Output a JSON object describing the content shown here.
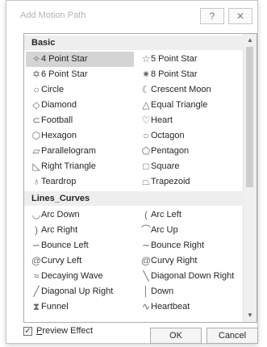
{
  "dialog": {
    "title": "Add Motion Path",
    "help_icon": "question-mark-icon",
    "close_icon": "close-icon"
  },
  "sections": [
    {
      "header": "Basic",
      "items": [
        {
          "label": "4 Point Star",
          "icon": "four-point-star-icon",
          "glyph": "✧",
          "selected": true
        },
        {
          "label": "5 Point Star",
          "icon": "five-point-star-icon",
          "glyph": "☆"
        },
        {
          "label": "6 Point Star",
          "icon": "six-point-star-icon",
          "glyph": "✡"
        },
        {
          "label": "8 Point Star",
          "icon": "eight-point-star-icon",
          "glyph": "✷"
        },
        {
          "label": "Circle",
          "icon": "circle-icon",
          "glyph": "○"
        },
        {
          "label": "Crescent Moon",
          "icon": "crescent-moon-icon",
          "glyph": "☾"
        },
        {
          "label": "Diamond",
          "icon": "diamond-icon",
          "glyph": "◇"
        },
        {
          "label": "Equal Triangle",
          "icon": "equal-triangle-icon",
          "glyph": "△"
        },
        {
          "label": "Football",
          "icon": "football-icon",
          "glyph": "⊂"
        },
        {
          "label": "Heart",
          "icon": "heart-icon",
          "glyph": "♡"
        },
        {
          "label": "Hexagon",
          "icon": "hexagon-icon",
          "glyph": "⬡"
        },
        {
          "label": "Octagon",
          "icon": "octagon-icon",
          "glyph": "○"
        },
        {
          "label": "Parallelogram",
          "icon": "parallelogram-icon",
          "glyph": "▱"
        },
        {
          "label": "Pentagon",
          "icon": "pentagon-icon",
          "glyph": "⬠"
        },
        {
          "label": "Right Triangle",
          "icon": "right-triangle-icon",
          "glyph": "◺"
        },
        {
          "label": "Square",
          "icon": "square-icon",
          "glyph": "□"
        },
        {
          "label": "Teardrop",
          "icon": "teardrop-icon",
          "glyph": "♁"
        },
        {
          "label": "Trapezoid",
          "icon": "trapezoid-icon",
          "glyph": "⏢"
        }
      ]
    },
    {
      "header": "Lines_Curves",
      "items": [
        {
          "label": "Arc Down",
          "icon": "arc-down-icon",
          "glyph": "◡"
        },
        {
          "label": "Arc Left",
          "icon": "arc-left-icon",
          "glyph": "("
        },
        {
          "label": "Arc Right",
          "icon": "arc-right-icon",
          "glyph": ")"
        },
        {
          "label": "Arc Up",
          "icon": "arc-up-icon",
          "glyph": "⌒"
        },
        {
          "label": "Bounce Left",
          "icon": "bounce-left-icon",
          "glyph": "∽"
        },
        {
          "label": "Bounce Right",
          "icon": "bounce-right-icon",
          "glyph": "∼"
        },
        {
          "label": "Curvy Left",
          "icon": "curvy-left-icon",
          "glyph": "@"
        },
        {
          "label": "Curvy Right",
          "icon": "curvy-right-icon",
          "glyph": "@"
        },
        {
          "label": "Decaying Wave",
          "icon": "decaying-wave-icon",
          "glyph": "≈"
        },
        {
          "label": "Diagonal Down Right",
          "icon": "diagonal-down-right-icon",
          "glyph": "╲"
        },
        {
          "label": "Diagonal Up Right",
          "icon": "diagonal-up-right-icon",
          "glyph": "╱"
        },
        {
          "label": "Down",
          "icon": "down-line-icon",
          "glyph": "│"
        },
        {
          "label": "Funnel",
          "icon": "funnel-icon",
          "glyph": "⧗"
        },
        {
          "label": "Heartbeat",
          "icon": "heartbeat-icon",
          "glyph": "∿"
        }
      ]
    }
  ],
  "footer": {
    "preview_label_underlined": "P",
    "preview_label_rest": "review Effect",
    "preview_checked": true,
    "check_glyph": "✓",
    "ok_label": "OK",
    "cancel_label": "Cancel"
  },
  "scrollbar": {
    "up_glyph": "▲",
    "down_glyph": "▼"
  }
}
